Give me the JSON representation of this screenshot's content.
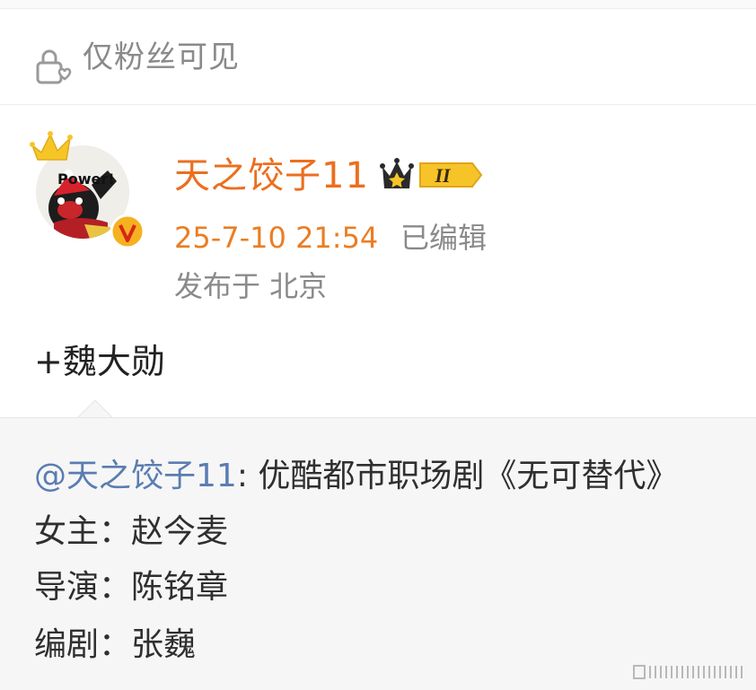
{
  "visibility": {
    "icon": "lock-heart-icon",
    "label": "仅粉丝可见"
  },
  "author": {
    "avatar_caption": "Power!",
    "name": "天之饺子11",
    "level_badge": "II",
    "verified_icon": "v-badge-icon",
    "crown_icon": "crown-icon"
  },
  "post": {
    "time": "25-7-10 21:54",
    "edited": "已编辑",
    "location": "发布于 北京",
    "text": "+魏大勋"
  },
  "repost": {
    "mention": "@天之饺子11",
    "text": ": 优酷都市职场剧《无可替代》",
    "lines": [
      {
        "label": "女主：",
        "value": "赵今麦"
      },
      {
        "label": "导演：",
        "value": "陈铭章"
      },
      {
        "label": "编剧：",
        "value": "张巍"
      }
    ]
  },
  "colors": {
    "username": "#eb6f1f",
    "time": "#eb7d23",
    "mention": "#5b7db1",
    "muted": "#8a8a8a"
  }
}
